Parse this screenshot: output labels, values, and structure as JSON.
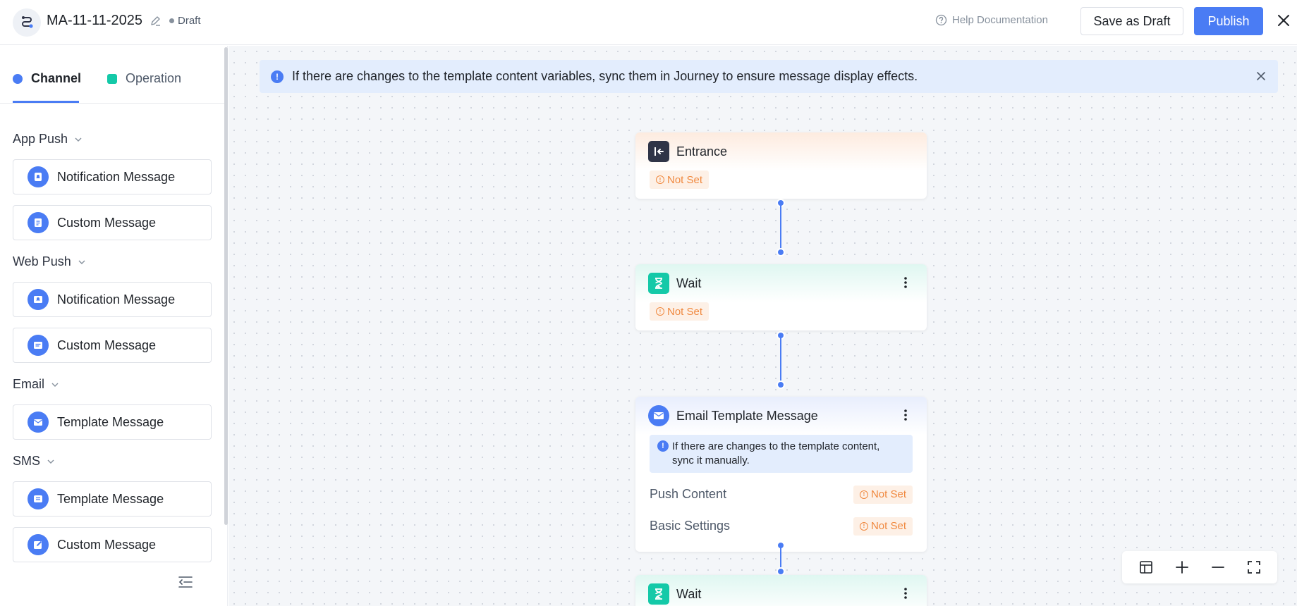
{
  "header": {
    "title": "MA-11-11-2025",
    "status": "Draft",
    "help": "Help Documentation",
    "save_draft": "Save as Draft",
    "publish": "Publish"
  },
  "sidebar": {
    "tabs": [
      {
        "label": "Channel",
        "active": true
      },
      {
        "label": "Operation",
        "active": false
      }
    ],
    "groups": [
      {
        "title": "App Push",
        "items": [
          {
            "label": "Notification Message",
            "icon": "notification-icon"
          },
          {
            "label": "Custom Message",
            "icon": "document-icon"
          }
        ]
      },
      {
        "title": "Web Push",
        "items": [
          {
            "label": "Notification Message",
            "icon": "notification-icon"
          },
          {
            "label": "Custom Message",
            "icon": "message-icon"
          }
        ]
      },
      {
        "title": "Email",
        "items": [
          {
            "label": "Template Message",
            "icon": "mail-icon"
          }
        ]
      },
      {
        "title": "SMS",
        "items": [
          {
            "label": "Template Message",
            "icon": "chat-icon"
          },
          {
            "label": "Custom Message",
            "icon": "edit-icon"
          }
        ]
      }
    ]
  },
  "canvas": {
    "banner": "If there are changes to the template content variables, sync them in Journey to ensure message display effects.",
    "nodes": {
      "entrance": {
        "title": "Entrance",
        "status": "Not Set"
      },
      "wait1": {
        "title": "Wait",
        "status": "Not Set"
      },
      "email": {
        "title": "Email Template Message",
        "note": "If there are changes to the template content, sync it manually.",
        "rows": [
          {
            "label": "Push Content",
            "status": "Not Set"
          },
          {
            "label": "Basic Settings",
            "status": "Not Set"
          }
        ]
      },
      "wait2": {
        "title": "Wait"
      }
    }
  },
  "colors": {
    "accent": "#4a7cf4",
    "wait": "#14c9a8",
    "warning": "#f0883e",
    "entrance": "#2f3447"
  }
}
